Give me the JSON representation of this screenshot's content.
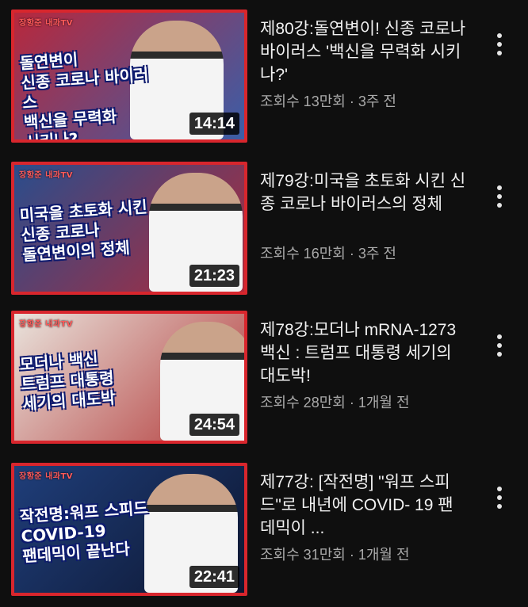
{
  "videos": [
    {
      "title": "제80강:돌연변이! 신종 코로나 바이러스 '백신을 무력화 시키나?'",
      "meta": "조회수 13만회 · 3주 전",
      "duration": "14:14",
      "channel_watermark": "장항준 내과TV",
      "thumb_text": "돌연변이\n신종 코로나 바이러스\n백신을 무력화\n시키나?",
      "thumb_bg": "#b8283c",
      "thumb_bg2": "#3a5ea8"
    },
    {
      "title": "제79강:미국을 초토화 시킨 신종 코로나 바이러스의 정체",
      "meta": "조회수 16만회 · 3주 전",
      "duration": "21:23",
      "channel_watermark": "장항준 내과TV",
      "thumb_text": "미국을 초토화 시킨\n신종 코로나\n돌연변이의 정체",
      "thumb_bg": "#2a4d8c",
      "thumb_bg2": "#b12a3a"
    },
    {
      "title": "제78강:모더나 mRNA-1273 백신 : 트럼프 대통령 세기의 대도박!",
      "meta": "조회수 28만회 · 1개월 전",
      "duration": "24:54",
      "channel_watermark": "장항준 내과TV",
      "thumb_text": "모더나 백신\n트럼프 대통령\n세기의 대도박",
      "thumb_bg": "#e9e3dc",
      "thumb_bg2": "#b33a3a"
    },
    {
      "title": "제77강: [작전명] \"워프 스피드\"로 내년에 COVID- 19 팬데믹이 ...",
      "meta": "조회수 31만회 · 1개월 전",
      "duration": "22:41",
      "channel_watermark": "장항준 내과TV",
      "thumb_text": "작전명:워프 스피드\nCOVID-19\n팬데믹이 끝난다",
      "thumb_bg": "#1f3e7a",
      "thumb_bg2": "#0d1630"
    }
  ],
  "icons": {
    "menu": "more-vert-icon"
  },
  "colors": {
    "background": "#0f0f0f",
    "accent_border": "#d8262d",
    "meta_text": "#aaaaaa"
  }
}
